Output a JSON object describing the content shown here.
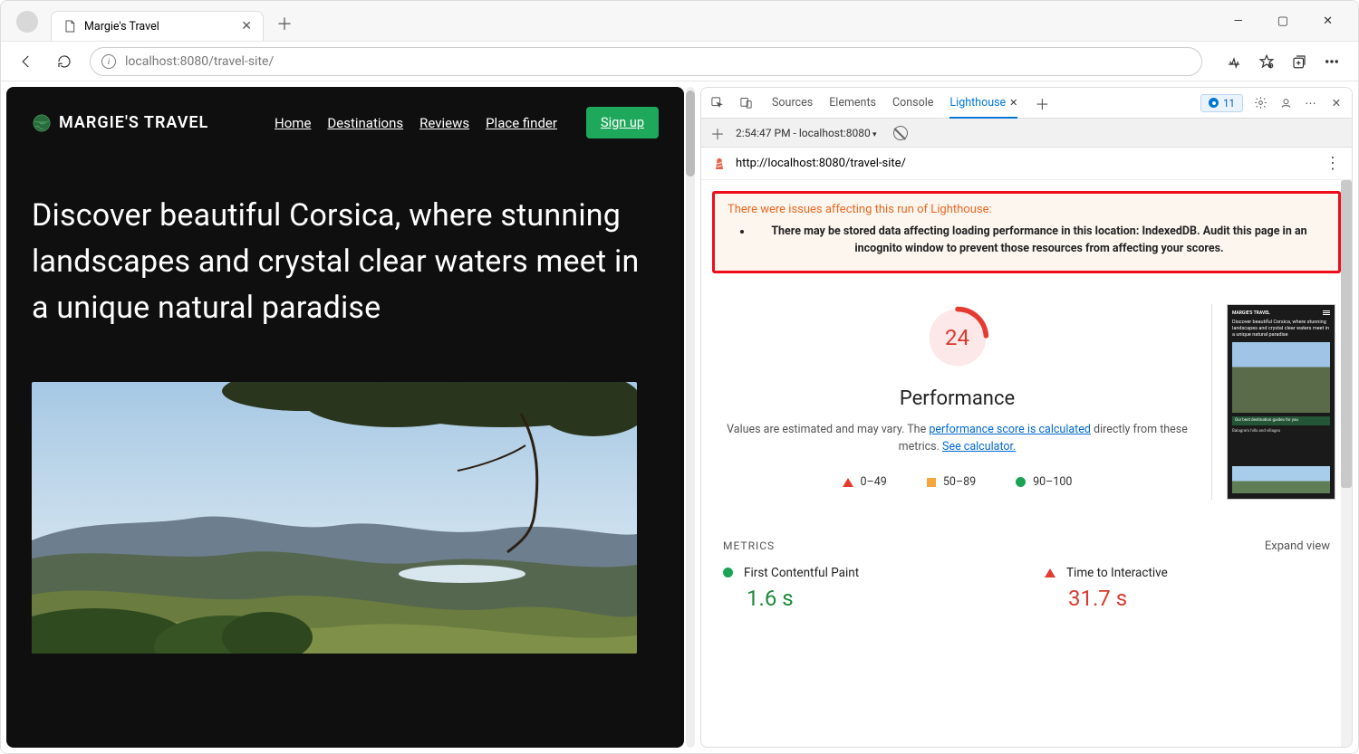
{
  "browser": {
    "tab_title": "Margie's Travel",
    "url_display": "localhost:8080/travel-site/",
    "issues_count": "11"
  },
  "site": {
    "brand": "MARGIE'S TRAVEL",
    "nav": {
      "home": "Home",
      "destinations": "Destinations",
      "reviews": "Reviews",
      "placefinder": "Place finder"
    },
    "signup": "Sign up",
    "hero": "Discover beautiful Corsica, where stunning landscapes and crystal clear waters meet in a unique natural paradise"
  },
  "devtools": {
    "tabs": {
      "sources": "Sources",
      "elements": "Elements",
      "console": "Console",
      "lighthouse": "Lighthouse"
    },
    "run_label": "2:54:47 PM - localhost:8080",
    "page_url": "http://localhost:8080/travel-site/",
    "warning_title": "There were issues affecting this run of Lighthouse:",
    "warning_item": "There may be stored data affecting loading performance in this location: IndexedDB. Audit this page in an incognito window to prevent those resources from affecting your scores.",
    "score": "24",
    "score_label": "Performance",
    "desc_pre": "Values are estimated and may vary. The ",
    "desc_link1": "performance score is calculated",
    "desc_mid": " directly from these metrics. ",
    "desc_link2": "See calculator.",
    "legend": {
      "low": "0–49",
      "mid": "50–89",
      "high": "90–100"
    },
    "metrics_label": "METRICS",
    "expand": "Expand view",
    "metric1": {
      "name": "First Contentful Paint",
      "value": "1.6 s"
    },
    "metric2": {
      "name": "Time to Interactive",
      "value": "31.7 s"
    },
    "preview": {
      "brand": "MARGIE'S TRAVEL",
      "hero": "Discover beautiful Corsica, where stunning landscapes and crystal clear waters meet in a unique natural paradise",
      "band": "Our best destination guides for you",
      "line": "Balagne's hills and villages"
    }
  }
}
